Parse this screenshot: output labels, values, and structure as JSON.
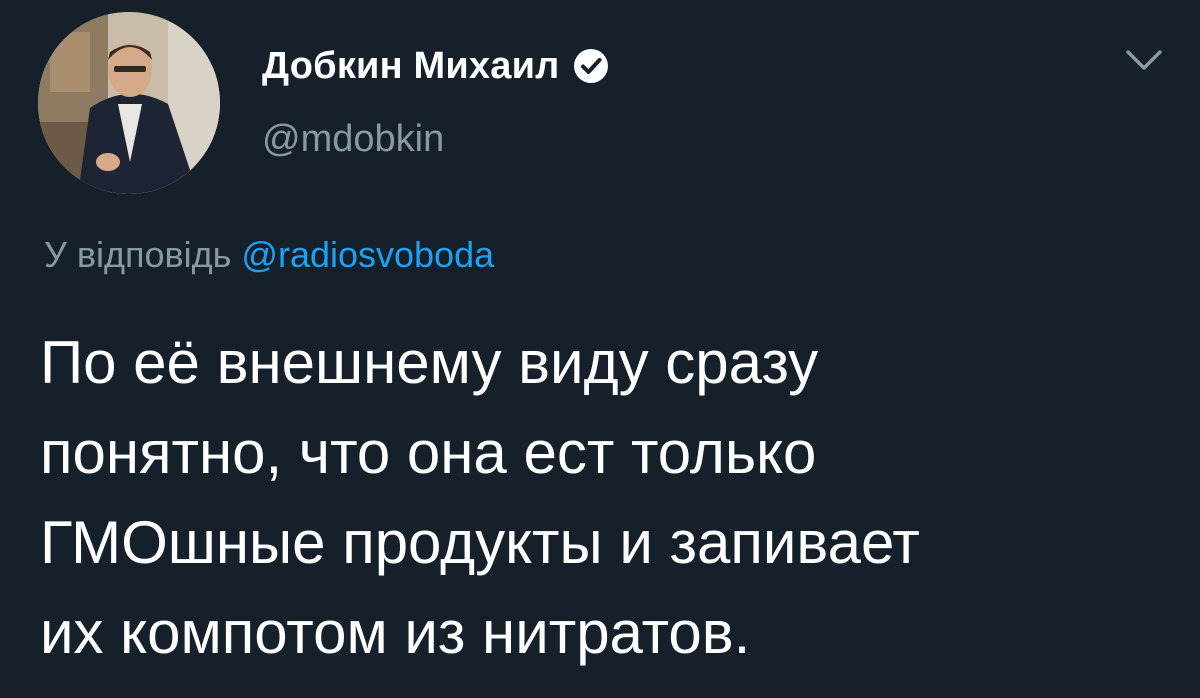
{
  "author": {
    "display_name": "Добкин Михаил",
    "handle": "@mdobkin",
    "verified": true
  },
  "reply": {
    "prefix": "У відповідь",
    "mention": "@radiosvoboda"
  },
  "tweet": {
    "lines": [
      "По её внешнему виду сразу",
      "понятно, что она ест только",
      "ГМОшные продукты и запивает",
      "их компотом из нитратов."
    ]
  },
  "icons": {
    "verified": "verified-badge-icon",
    "menu": "chevron-down-icon"
  },
  "colors": {
    "background": "#15202b",
    "secondary_text": "#8899a6",
    "accent": "#1da1f2",
    "primary_text": "#ffffff"
  }
}
